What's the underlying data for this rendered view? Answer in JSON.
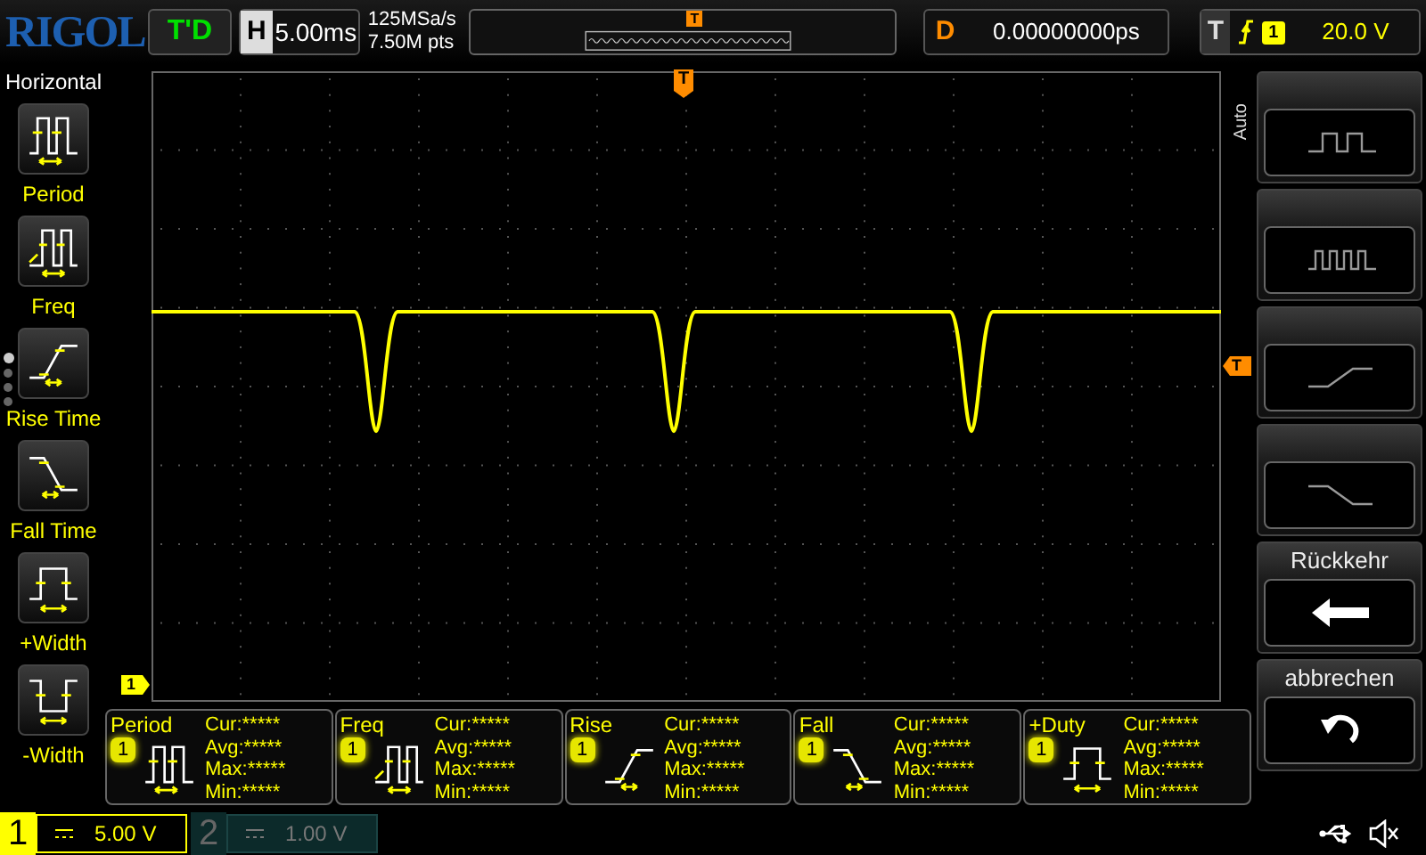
{
  "top_bar": {
    "logo": "RIGOL",
    "run_status": "T'D",
    "timebase": {
      "label": "H",
      "value": "5.00ms"
    },
    "sample_rate": "125MSa/s",
    "memory_depth": "7.50M pts",
    "overview_marker": "T",
    "delay": {
      "label": "D",
      "value": "0.00000000ps"
    },
    "trigger": {
      "label": "T",
      "source": "1",
      "level": "20.0 V"
    }
  },
  "left_menu": {
    "title": "Horizontal",
    "pages": [
      {
        "selected": true
      },
      {
        "selected": false
      },
      {
        "selected": false
      },
      {
        "selected": false
      }
    ],
    "items": [
      {
        "label": "Period",
        "kind": "period"
      },
      {
        "label": "Freq",
        "kind": "freq"
      },
      {
        "label": "Rise Time",
        "kind": "rise"
      },
      {
        "label": "Fall Time",
        "kind": "fall"
      },
      {
        "label": "+Width",
        "kind": "pwidth"
      },
      {
        "label": "-Width",
        "kind": "nwidth"
      }
    ]
  },
  "screen": {
    "trigger_position_marker": "T",
    "trigger_level_marker": "T",
    "channel_ground_marker": "1"
  },
  "right_menu": {
    "title": "Auto",
    "items": [
      {
        "kind": "pulse2"
      },
      {
        "kind": "pulse4"
      },
      {
        "kind": "rise"
      },
      {
        "kind": "fall"
      },
      {
        "kind": "back",
        "label": "Rückkehr"
      },
      {
        "kind": "undo",
        "label": "abbrechen"
      }
    ]
  },
  "measurements": [
    {
      "name": "Period",
      "channel": "1",
      "kind": "period",
      "lines": [
        "Cur:*****",
        "Avg:*****",
        "Max:*****",
        "Min:*****"
      ]
    },
    {
      "name": "Freq",
      "channel": "1",
      "kind": "freq",
      "lines": [
        "Cur:*****",
        "Avg:*****",
        "Max:*****",
        "Min:*****"
      ]
    },
    {
      "name": "Rise",
      "channel": "1",
      "kind": "rise",
      "lines": [
        "Cur:*****",
        "Avg:*****",
        "Max:*****",
        "Min:*****"
      ]
    },
    {
      "name": "Fall",
      "channel": "1",
      "kind": "fall",
      "lines": [
        "Cur:*****",
        "Avg:*****",
        "Max:*****",
        "Min:*****"
      ]
    },
    {
      "name": "+Duty",
      "channel": "1",
      "kind": "pwidth",
      "lines": [
        "Cur:*****",
        "Avg:*****",
        "Max:*****",
        "Min:*****"
      ]
    }
  ],
  "channels": [
    {
      "number": "1",
      "scale": "5.00 V",
      "enabled": true
    },
    {
      "number": "2",
      "scale": "1.00 V",
      "enabled": false
    }
  ]
}
